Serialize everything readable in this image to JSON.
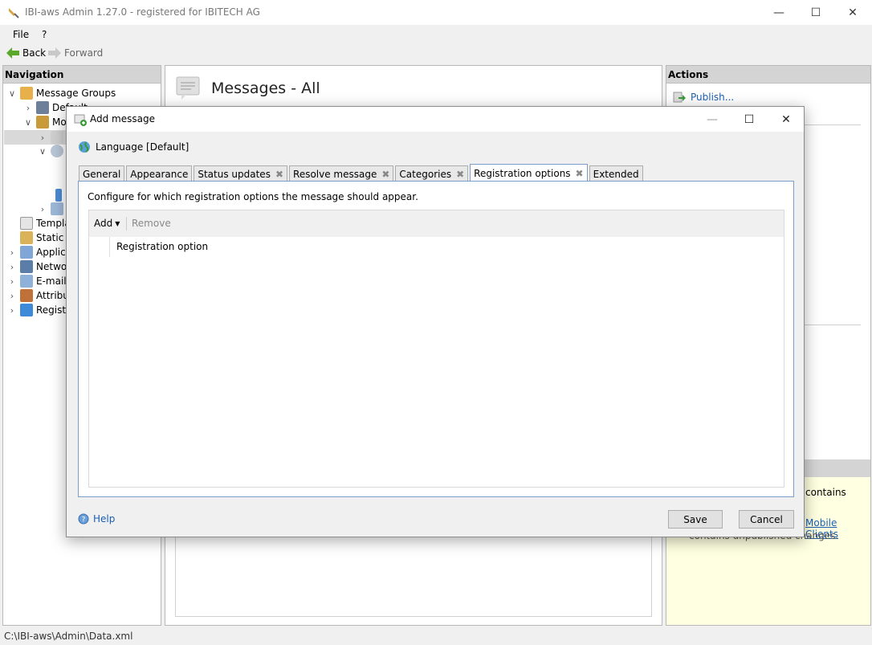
{
  "window": {
    "title": "IBI-aws Admin 1.27.0 - registered for IBITECH AG"
  },
  "menu": {
    "file": "File",
    "help": "?"
  },
  "toolbar": {
    "back": "Back",
    "forward": "Forward"
  },
  "navigation": {
    "header": "Navigation",
    "items": [
      {
        "label": "Message Groups",
        "expanded": true
      },
      {
        "label": "Default"
      },
      {
        "label": "Mo"
      },
      {
        "label": "Templa"
      },
      {
        "label": "Static M"
      },
      {
        "label": "Applica"
      },
      {
        "label": "Netwo"
      },
      {
        "label": "E-mail"
      },
      {
        "label": "Attribu"
      },
      {
        "label": "Registr"
      }
    ]
  },
  "center": {
    "title": "Messages - All"
  },
  "actions": {
    "header": "Actions",
    "publish": "Publish...",
    "hint_text": "contains",
    "hint_link": "Mobile Clients",
    "hint_text2": "contains unpublished changes."
  },
  "status": {
    "path": "C:\\IBI-aws\\Admin\\Data.xml"
  },
  "dialog": {
    "title": "Add message",
    "language": "Language [Default]",
    "tabs": [
      {
        "label": "General",
        "closable": false
      },
      {
        "label": "Appearance",
        "closable": false
      },
      {
        "label": "Status updates",
        "closable": true
      },
      {
        "label": "Resolve message",
        "closable": true
      },
      {
        "label": "Categories",
        "closable": true
      },
      {
        "label": "Registration options",
        "closable": true,
        "active": true
      },
      {
        "label": "Extended",
        "closable": false
      }
    ],
    "description": "Configure for which registration options the message should appear.",
    "grid": {
      "add": "Add",
      "remove": "Remove",
      "column": "Registration option"
    },
    "help": "Help",
    "save": "Save",
    "cancel": "Cancel"
  },
  "colors": {
    "accent": "#1a5fb4",
    "hint_bg": "#ffffe1",
    "tab_border": "#7a9cc7"
  }
}
